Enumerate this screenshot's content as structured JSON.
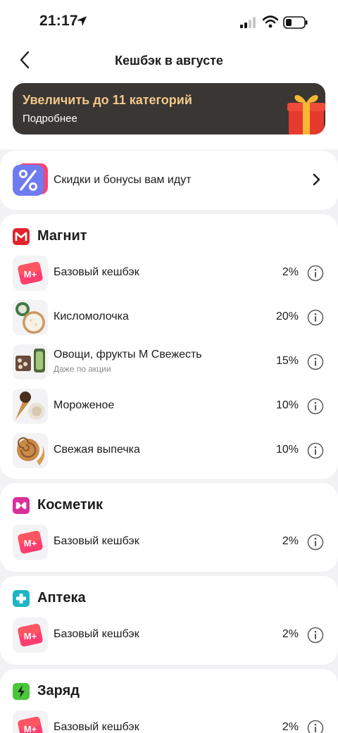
{
  "status": {
    "time": "21:17"
  },
  "nav": {
    "title": "Кешбэк в августе"
  },
  "promo": {
    "title": "Увеличить до 11 категорий",
    "subtitle": "Подробнее"
  },
  "discounts": {
    "label": "Скидки и бонусы вам идут"
  },
  "stores": [
    {
      "name": "Магнит",
      "color": "#e4232d",
      "items": [
        {
          "label": "Базовый кешбэк",
          "percent": "2%"
        },
        {
          "label": "Кисломолочка",
          "percent": "20%"
        },
        {
          "label": "Овощи, фрукты М Свежесть",
          "note": "Даже по акции",
          "percent": "15%"
        },
        {
          "label": "Мороженое",
          "percent": "10%"
        },
        {
          "label": "Свежая выпечка",
          "percent": "10%"
        }
      ]
    },
    {
      "name": "Косметик",
      "color": "#d9309a",
      "items": [
        {
          "label": "Базовый кешбэк",
          "percent": "2%"
        }
      ]
    },
    {
      "name": "Аптека",
      "color": "#1fb5c6",
      "items": [
        {
          "label": "Базовый кешбэк",
          "percent": "2%"
        }
      ]
    },
    {
      "name": "Заряд",
      "color": "#49c63a",
      "items": [
        {
          "label": "Базовый кешбэк",
          "percent": "2%"
        }
      ]
    }
  ],
  "icons": {
    "location": "location-arrow-icon",
    "signal": "signal-icon",
    "wifi": "wifi-icon",
    "battery": "battery-icon",
    "back": "back-icon",
    "gift": "gift-icon",
    "percent": "percent-icon",
    "chevron": "chevron-right-icon",
    "info": "info-icon"
  }
}
